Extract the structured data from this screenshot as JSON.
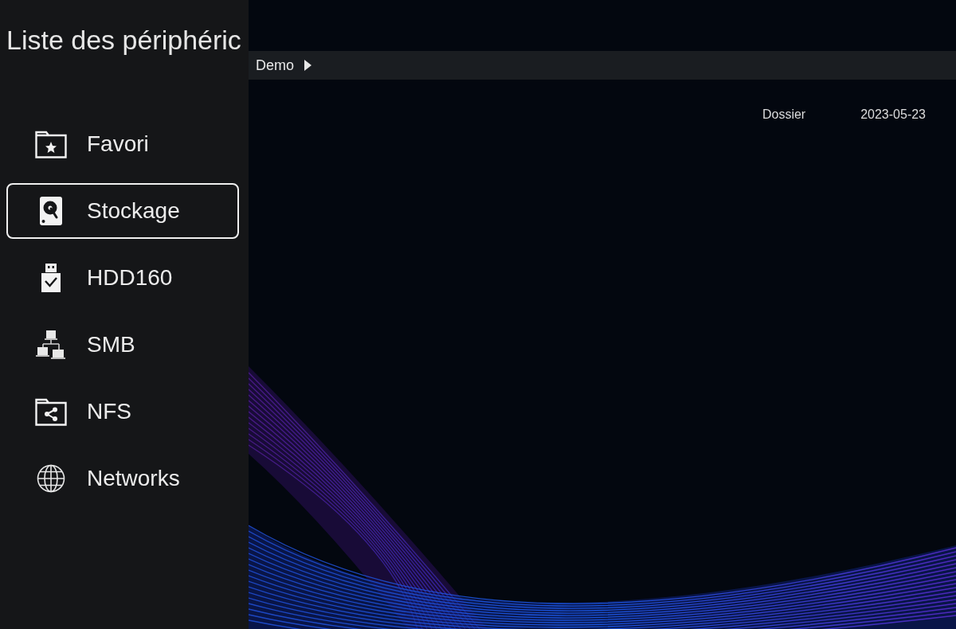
{
  "sidebar": {
    "title": "Liste des périphéric",
    "items": [
      {
        "label": "Favori",
        "kind": "favorite",
        "selected": false
      },
      {
        "label": "Stockage",
        "kind": "storage",
        "selected": true
      },
      {
        "label": "HDD160",
        "kind": "usb",
        "selected": false
      },
      {
        "label": "SMB",
        "kind": "smb",
        "selected": false
      },
      {
        "label": "NFS",
        "kind": "nfs",
        "selected": false
      },
      {
        "label": "Networks",
        "kind": "network",
        "selected": false
      }
    ]
  },
  "breadcrumb": [
    "Demo"
  ],
  "files": [
    {
      "type": "Dossier",
      "date": "2023-05-23"
    }
  ]
}
